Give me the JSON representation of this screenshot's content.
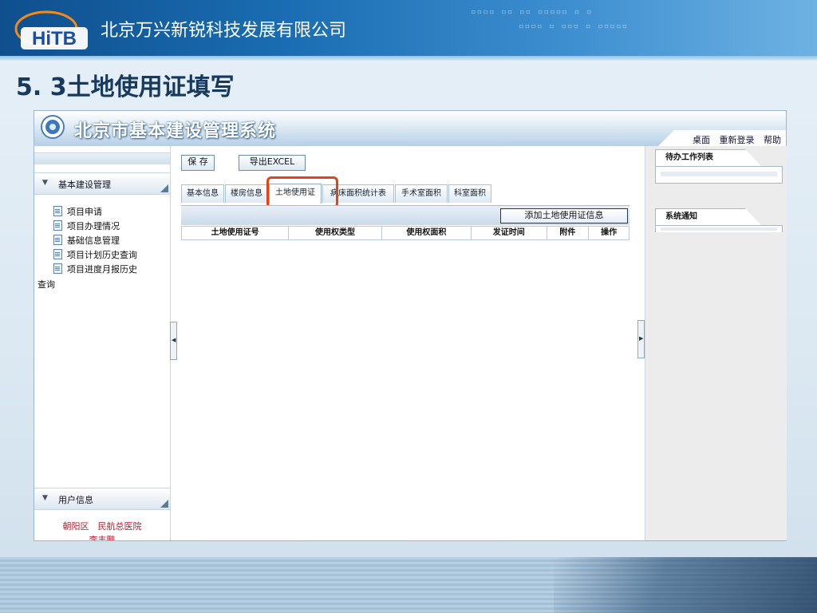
{
  "company": {
    "logo_text": "HiTB",
    "name": "北京万兴新锐科技发展有限公司"
  },
  "slide_title": "5. 3土地使用证填写",
  "app": {
    "system_title": "北京市基本建设管理系统",
    "header_links": [
      "桌面",
      "重新登录",
      "帮助"
    ]
  },
  "sidebar": {
    "section_title": "基本建设管理",
    "items": [
      {
        "label": "项目申请"
      },
      {
        "label": "项目办理情况"
      },
      {
        "label": "基础信息管理"
      },
      {
        "label": "项目计划历史查询"
      },
      {
        "label": "项目进度月报历史"
      }
    ],
    "wrap_text": "查询",
    "user_section_title": "用户信息",
    "user_org": "朝阳区　民航总医院",
    "user_name": "李丰鹏"
  },
  "toolbar": {
    "save_label": "保 存",
    "export_label": "导出EXCEL"
  },
  "tabs": [
    {
      "label": "基本信息"
    },
    {
      "label": "楼房信息"
    },
    {
      "label": "土地使用证",
      "active": true
    },
    {
      "label": "病床面积统计表"
    },
    {
      "label": "手术室面积"
    },
    {
      "label": "科室面积"
    }
  ],
  "grid": {
    "add_button": "添加土地使用证信息",
    "columns": [
      "土地使用证号",
      "使用权类型",
      "使用权面积",
      "发证时间",
      "附件",
      "操作"
    ]
  },
  "right_panel": {
    "todo_title": "待办工作列表",
    "notice_title": "系统通知"
  },
  "colors": {
    "accent_highlight": "#e04418",
    "header_blue": "#1a6db2",
    "user_text": "#c0142a"
  }
}
